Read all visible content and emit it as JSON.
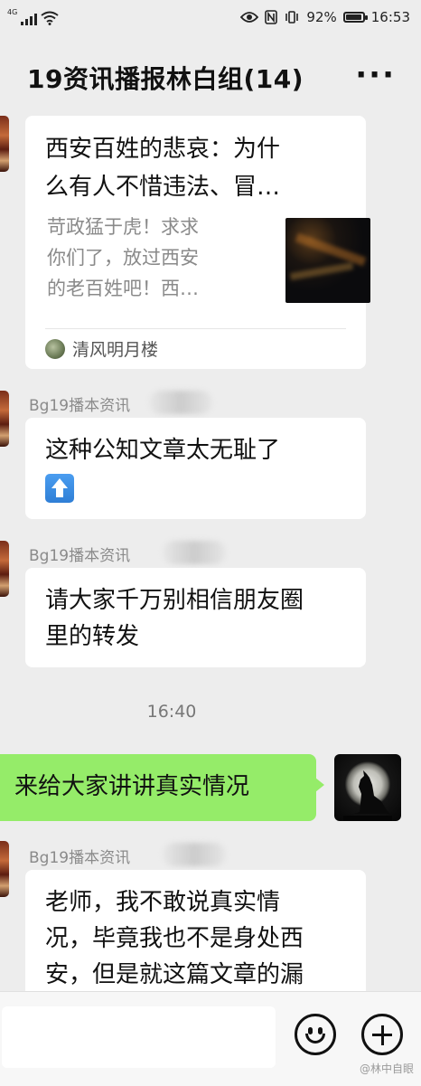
{
  "status_bar": {
    "network": "4G",
    "battery": "92%",
    "battery_level": 0.92,
    "time": "16:53"
  },
  "header": {
    "title": "19资讯播报林白组(14)",
    "more_icon": "more-dots-icon"
  },
  "messages": {
    "link_card": {
      "title_line1": "西安百姓的悲哀：为什",
      "title_line2": "么有人不惜违法、冒…",
      "desc_line1": "苛政猛于虎！求求",
      "desc_line2": "你们了，放过西安",
      "desc_line3": "的老百姓吧！西…",
      "source": "清风明月楼"
    },
    "msg1": {
      "sender": "Bg19播本资讯",
      "line1": "这种公知文章太无耻了",
      "emoji": "up-arrow-emoji"
    },
    "msg2": {
      "sender": "Bg19播本资讯",
      "line1": "请大家千万别相信朋友圈",
      "line2": "里的转发"
    },
    "timestamp": "16:40",
    "my_msg": {
      "text": "来给大家讲讲真实情况"
    },
    "msg3": {
      "sender": "Bg19播本资讯",
      "line1": "老师，我不敢说真实情",
      "line2": "况，毕竟我也不是身处西",
      "line3": "安，但是就这篇文章的漏"
    }
  },
  "input_bar": {
    "placeholder": "",
    "emoji_icon": "smiley-icon",
    "plus_icon": "plus-circle-icon"
  },
  "watermark": "@林中自眼",
  "colors": {
    "my_bubble": "#95ec69",
    "background": "#ededed"
  }
}
